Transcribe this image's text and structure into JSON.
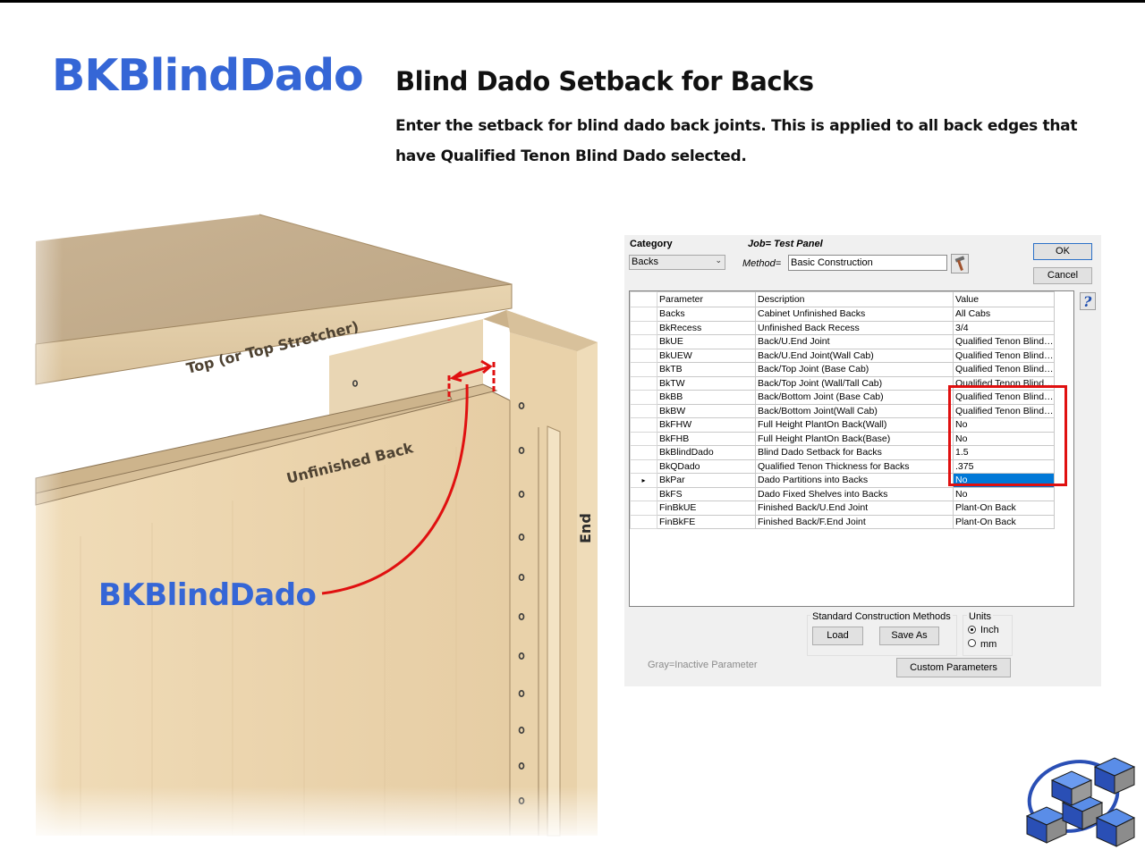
{
  "slide": {
    "title": "BKBlindDado",
    "subtitle": "Blind Dado Setback for Backs",
    "description": "Enter the setback for blind dado back joints. This is applied to all back edges that have Qualified Tenon Blind Dado selected."
  },
  "illustration": {
    "top_label": "Top (or Top Stretcher)",
    "back_label": "Unfinished Back",
    "end_label": "End",
    "callout_label": "BKBlindDado",
    "callout_color": "#3566d6",
    "marker_color": "#e01010"
  },
  "dialog": {
    "category_label": "Category",
    "category_value": "Backs",
    "job_label": "Job= Test Panel",
    "method_label": "Method=",
    "method_value": "Basic Construction",
    "ok_label": "OK",
    "cancel_label": "Cancel",
    "help_icon": "question-mark-icon",
    "hammer_icon": "hammer-icon",
    "columns": [
      "Parameter",
      "Description",
      "Value"
    ],
    "rows": [
      {
        "param": "Backs",
        "desc": "Cabinet Unfinished Backs",
        "value": "All Cabs"
      },
      {
        "param": "BkRecess",
        "desc": "Unfinished Back Recess",
        "value": "3/4"
      },
      {
        "param": "BkUE",
        "desc": "Back/U.End Joint",
        "value": "Qualified Tenon Blind Dado"
      },
      {
        "param": "BkUEW",
        "desc": "Back/U.End Joint(Wall Cab)",
        "value": "Qualified Tenon Blind Dado"
      },
      {
        "param": "BkTB",
        "desc": "Back/Top Joint (Base Cab)",
        "value": "Qualified Tenon Blind Dado"
      },
      {
        "param": "BkTW",
        "desc": "Back/Top Joint (Wall/Tall Cab)",
        "value": "Qualified Tenon Blind Dado"
      },
      {
        "param": "BkBB",
        "desc": "Back/Bottom Joint (Base Cab)",
        "value": "Qualified Tenon Blind Dado"
      },
      {
        "param": "BkBW",
        "desc": "Back/Bottom Joint(Wall Cab)",
        "value": "Qualified Tenon Blind Dado"
      },
      {
        "param": "BkFHW",
        "desc": "Full Height PlantOn Back(Wall)",
        "value": "No"
      },
      {
        "param": "BkFHB",
        "desc": "Full Height PlantOn Back(Base)",
        "value": "No"
      },
      {
        "param": "BkBlindDado",
        "desc": "Blind Dado Setback for Backs",
        "value": "1.5"
      },
      {
        "param": "BkQDado",
        "desc": "Qualified Tenon Thickness for Backs",
        "value": ".375"
      },
      {
        "param": "BkPar",
        "desc": "Dado Partitions into Backs",
        "value": "No",
        "selected": true
      },
      {
        "param": "BkFS",
        "desc": "Dado Fixed Shelves into Backs",
        "value": "No"
      },
      {
        "param": "FinBkUE",
        "desc": "Finished Back/U.End Joint",
        "value": "Plant-On Back"
      },
      {
        "param": "FinBkFE",
        "desc": "Finished Back/F.End Joint",
        "value": "Plant-On Back"
      }
    ],
    "std_methods_label": "Standard Construction Methods",
    "load_label": "Load",
    "save_as_label": "Save As",
    "units_label": "Units",
    "inch_label": "Inch",
    "mm_label": "mm",
    "units_selected": "Inch",
    "gray_note": "Gray=Inactive Parameter",
    "custom_params_label": "Custom Parameters",
    "selection_color": "#0078d7"
  }
}
